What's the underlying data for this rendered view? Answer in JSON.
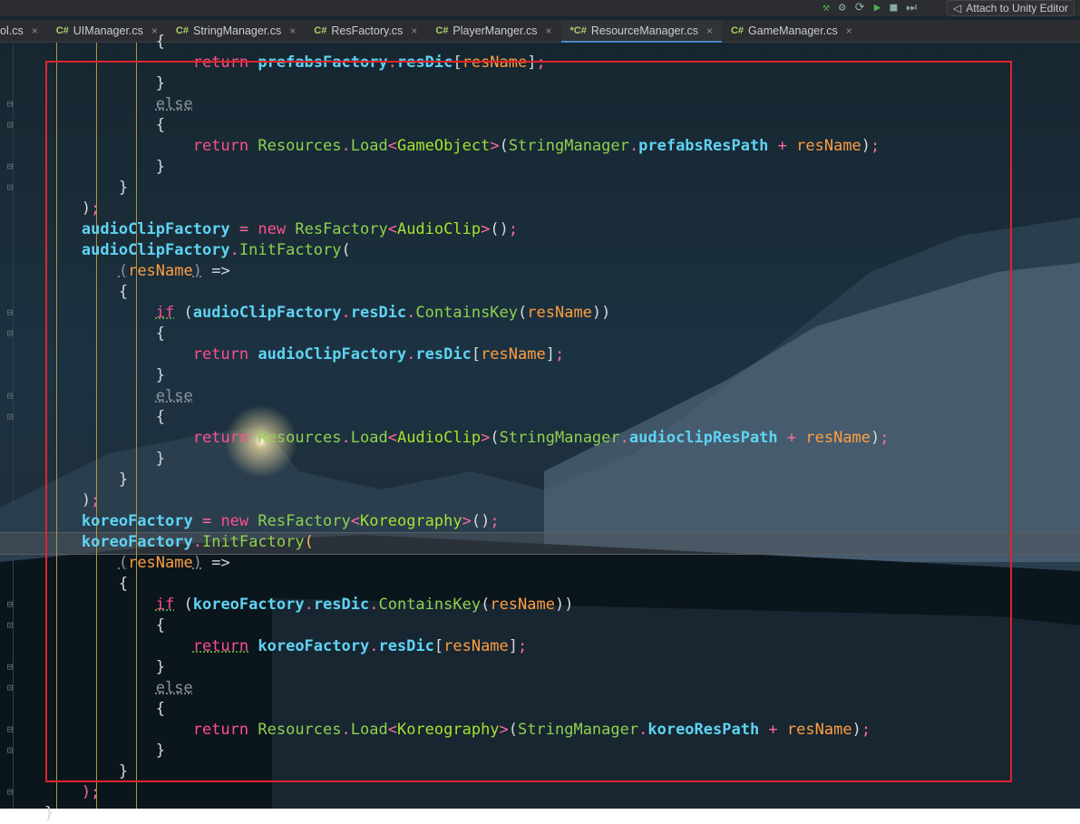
{
  "toolbar": {
    "attach_label": "Attach to Unity Editor",
    "icons": [
      "build-hammer-icon",
      "unity-debug-icon",
      "unity-attach-icon",
      "play-icon",
      "stop-icon",
      "step-icon"
    ]
  },
  "tabs": [
    {
      "label": "ol.cs",
      "cs": false,
      "active": false,
      "modified": false
    },
    {
      "label": "UIManager.cs",
      "cs": true,
      "active": false,
      "modified": false
    },
    {
      "label": "StringManager.cs",
      "cs": true,
      "active": false,
      "modified": false
    },
    {
      "label": "ResFactory.cs",
      "cs": true,
      "active": false,
      "modified": false
    },
    {
      "label": "PlayerManger.cs",
      "cs": true,
      "active": false,
      "modified": false
    },
    {
      "label": "ResourceManager.cs",
      "cs": true,
      "active": true,
      "modified": true
    },
    {
      "label": "GameManager.cs",
      "cs": true,
      "active": false,
      "modified": false
    }
  ],
  "cs_badge": "C#",
  "modified_marker": "*",
  "close_glyph": "×",
  "colors": {
    "annotation_box": "#e0242a",
    "active_tab_underline": "#4a88c7",
    "keyword": "#ff4f8b",
    "field": "#5fd3f3",
    "method": "#8fd14f",
    "type": "#a6e22e",
    "parameter": "#ff9d40"
  },
  "code_lines": [
    [
      {
        "t": "                ",
        "c": ""
      },
      {
        "t": "{",
        "c": "pun"
      }
    ],
    [
      {
        "t": "                    ",
        "c": ""
      },
      {
        "t": "return",
        "c": "k"
      },
      {
        "t": " ",
        "c": ""
      },
      {
        "t": "prefabsFactory",
        "c": "fld"
      },
      {
        "t": ".",
        "c": "op"
      },
      {
        "t": "resDic",
        "c": "fld"
      },
      {
        "t": "[",
        "c": "pun"
      },
      {
        "t": "resName",
        "c": "par"
      },
      {
        "t": "]",
        "c": "pun"
      },
      {
        "t": ";",
        "c": "sem"
      }
    ],
    [
      {
        "t": "                ",
        "c": ""
      },
      {
        "t": "}",
        "c": "pun"
      }
    ],
    [
      {
        "t": "                ",
        "c": ""
      },
      {
        "t": "else",
        "c": "gray"
      }
    ],
    [
      {
        "t": "                ",
        "c": ""
      },
      {
        "t": "{",
        "c": "pun"
      }
    ],
    [
      {
        "t": "                    ",
        "c": ""
      },
      {
        "t": "return",
        "c": "k"
      },
      {
        "t": " ",
        "c": ""
      },
      {
        "t": "Resources",
        "c": "mth"
      },
      {
        "t": ".",
        "c": "op"
      },
      {
        "t": "Load",
        "c": "mth"
      },
      {
        "t": "<",
        "c": "op"
      },
      {
        "t": "GameObject",
        "c": "typ"
      },
      {
        "t": ">",
        "c": "op"
      },
      {
        "t": "(",
        "c": "pun"
      },
      {
        "t": "StringManager",
        "c": "mth"
      },
      {
        "t": ".",
        "c": "op"
      },
      {
        "t": "prefabsResPath",
        "c": "fld"
      },
      {
        "t": " + ",
        "c": "op"
      },
      {
        "t": "resName",
        "c": "par"
      },
      {
        "t": ")",
        "c": "pun"
      },
      {
        "t": ";",
        "c": "sem"
      }
    ],
    [
      {
        "t": "                ",
        "c": ""
      },
      {
        "t": "}",
        "c": "pun"
      }
    ],
    [
      {
        "t": "            ",
        "c": ""
      },
      {
        "t": "}",
        "c": "pun"
      }
    ],
    [
      {
        "t": "        ",
        "c": ""
      },
      {
        "t": ")",
        "c": "pun"
      },
      {
        "t": ";",
        "c": "sem"
      }
    ],
    [
      {
        "t": "        ",
        "c": ""
      },
      {
        "t": "audioClipFactory",
        "c": "fld"
      },
      {
        "t": " = ",
        "c": "op"
      },
      {
        "t": "new",
        "c": "k"
      },
      {
        "t": " ",
        "c": ""
      },
      {
        "t": "ResFactory",
        "c": "mth"
      },
      {
        "t": "<",
        "c": "op"
      },
      {
        "t": "AudioClip",
        "c": "typ"
      },
      {
        "t": ">",
        "c": "op"
      },
      {
        "t": "()",
        "c": "pun"
      },
      {
        "t": ";",
        "c": "sem"
      }
    ],
    [
      {
        "t": "        ",
        "c": ""
      },
      {
        "t": "audioClipFactory",
        "c": "fld"
      },
      {
        "t": ".",
        "c": "op"
      },
      {
        "t": "InitFactory",
        "c": "mth"
      },
      {
        "t": "(",
        "c": "pun"
      }
    ],
    [
      {
        "t": "            ",
        "c": ""
      },
      {
        "t": "(",
        "c": "gray"
      },
      {
        "t": "resName",
        "c": "par"
      },
      {
        "t": ")",
        "c": "gray"
      },
      {
        "t": " =>",
        "c": "pun"
      }
    ],
    [
      {
        "t": "            ",
        "c": ""
      },
      {
        "t": "{",
        "c": "pun"
      }
    ],
    [
      {
        "t": "                ",
        "c": ""
      },
      {
        "t": "if",
        "c": "kw"
      },
      {
        "t": " (",
        "c": "pun"
      },
      {
        "t": "audioClipFactory",
        "c": "fld"
      },
      {
        "t": ".",
        "c": "op"
      },
      {
        "t": "resDic",
        "c": "fld"
      },
      {
        "t": ".",
        "c": "op"
      },
      {
        "t": "ContainsKey",
        "c": "mth"
      },
      {
        "t": "(",
        "c": "pun"
      },
      {
        "t": "resName",
        "c": "par"
      },
      {
        "t": "))",
        "c": "pun"
      }
    ],
    [
      {
        "t": "                ",
        "c": ""
      },
      {
        "t": "{",
        "c": "pun"
      }
    ],
    [
      {
        "t": "                    ",
        "c": ""
      },
      {
        "t": "return",
        "c": "k"
      },
      {
        "t": " ",
        "c": ""
      },
      {
        "t": "audioClipFactory",
        "c": "fld"
      },
      {
        "t": ".",
        "c": "op"
      },
      {
        "t": "resDic",
        "c": "fld"
      },
      {
        "t": "[",
        "c": "pun"
      },
      {
        "t": "resName",
        "c": "par"
      },
      {
        "t": "]",
        "c": "pun"
      },
      {
        "t": ";",
        "c": "sem"
      }
    ],
    [
      {
        "t": "                ",
        "c": ""
      },
      {
        "t": "}",
        "c": "pun"
      }
    ],
    [
      {
        "t": "                ",
        "c": ""
      },
      {
        "t": "else",
        "c": "gray"
      }
    ],
    [
      {
        "t": "                ",
        "c": ""
      },
      {
        "t": "{",
        "c": "pun"
      }
    ],
    [
      {
        "t": "                    ",
        "c": ""
      },
      {
        "t": "return",
        "c": "k"
      },
      {
        "t": " ",
        "c": ""
      },
      {
        "t": "Resources",
        "c": "mth"
      },
      {
        "t": ".",
        "c": "op"
      },
      {
        "t": "Load",
        "c": "mth"
      },
      {
        "t": "<",
        "c": "op"
      },
      {
        "t": "AudioClip",
        "c": "typ"
      },
      {
        "t": ">",
        "c": "op"
      },
      {
        "t": "(",
        "c": "pun"
      },
      {
        "t": "StringManager",
        "c": "mth"
      },
      {
        "t": ".",
        "c": "op"
      },
      {
        "t": "audioclipResPath",
        "c": "fld"
      },
      {
        "t": " + ",
        "c": "op"
      },
      {
        "t": "resName",
        "c": "par"
      },
      {
        "t": ")",
        "c": "pun"
      },
      {
        "t": ";",
        "c": "sem"
      }
    ],
    [
      {
        "t": "                ",
        "c": ""
      },
      {
        "t": "}",
        "c": "pun"
      }
    ],
    [
      {
        "t": "            ",
        "c": ""
      },
      {
        "t": "}",
        "c": "pun"
      }
    ],
    [
      {
        "t": "        ",
        "c": ""
      },
      {
        "t": ")",
        "c": "pun"
      },
      {
        "t": ";",
        "c": "sem"
      }
    ],
    [
      {
        "t": "        ",
        "c": ""
      },
      {
        "t": "koreoFactory",
        "c": "fld"
      },
      {
        "t": " = ",
        "c": "op"
      },
      {
        "t": "new",
        "c": "k"
      },
      {
        "t": " ",
        "c": ""
      },
      {
        "t": "ResFactory",
        "c": "mth"
      },
      {
        "t": "<",
        "c": "op"
      },
      {
        "t": "Koreography",
        "c": "typ"
      },
      {
        "t": ">",
        "c": "op"
      },
      {
        "t": "()",
        "c": "pun"
      },
      {
        "t": ";",
        "c": "sem"
      }
    ],
    [
      {
        "t": "        ",
        "c": ""
      },
      {
        "t": "koreoFactory",
        "c": "fld"
      },
      {
        "t": ".",
        "c": "op"
      },
      {
        "t": "InitFactory",
        "c": "mth"
      },
      {
        "t": "(",
        "c": "dim"
      }
    ],
    [
      {
        "t": "            ",
        "c": ""
      },
      {
        "t": "(",
        "c": "gray"
      },
      {
        "t": "resName",
        "c": "par"
      },
      {
        "t": ")",
        "c": "gray"
      },
      {
        "t": " =>",
        "c": "pun"
      }
    ],
    [
      {
        "t": "            ",
        "c": ""
      },
      {
        "t": "{",
        "c": "pun"
      }
    ],
    [
      {
        "t": "                ",
        "c": ""
      },
      {
        "t": "if",
        "c": "kw"
      },
      {
        "t": " (",
        "c": "pun"
      },
      {
        "t": "koreoFactory",
        "c": "fld"
      },
      {
        "t": ".",
        "c": "op"
      },
      {
        "t": "resDic",
        "c": "fld"
      },
      {
        "t": ".",
        "c": "op"
      },
      {
        "t": "ContainsKey",
        "c": "mth"
      },
      {
        "t": "(",
        "c": "pun"
      },
      {
        "t": "resName",
        "c": "par"
      },
      {
        "t": "))",
        "c": "pun"
      }
    ],
    [
      {
        "t": "                ",
        "c": ""
      },
      {
        "t": "{",
        "c": "pun"
      }
    ],
    [
      {
        "t": "                    ",
        "c": ""
      },
      {
        "t": "return",
        "c": "kw"
      },
      {
        "t": " ",
        "c": ""
      },
      {
        "t": "koreoFactory",
        "c": "fld"
      },
      {
        "t": ".",
        "c": "op"
      },
      {
        "t": "resDic",
        "c": "fld"
      },
      {
        "t": "[",
        "c": "pun"
      },
      {
        "t": "resName",
        "c": "par"
      },
      {
        "t": "]",
        "c": "pun"
      },
      {
        "t": ";",
        "c": "sem"
      }
    ],
    [
      {
        "t": "                ",
        "c": ""
      },
      {
        "t": "}",
        "c": "pun"
      }
    ],
    [
      {
        "t": "                ",
        "c": ""
      },
      {
        "t": "else",
        "c": "gray"
      }
    ],
    [
      {
        "t": "                ",
        "c": ""
      },
      {
        "t": "{",
        "c": "pun"
      }
    ],
    [
      {
        "t": "                    ",
        "c": ""
      },
      {
        "t": "return",
        "c": "k"
      },
      {
        "t": " ",
        "c": ""
      },
      {
        "t": "Resources",
        "c": "mth"
      },
      {
        "t": ".",
        "c": "op"
      },
      {
        "t": "Load",
        "c": "mth"
      },
      {
        "t": "<",
        "c": "op"
      },
      {
        "t": "Koreography",
        "c": "typ"
      },
      {
        "t": ">",
        "c": "op"
      },
      {
        "t": "(",
        "c": "pun"
      },
      {
        "t": "StringManager",
        "c": "mth"
      },
      {
        "t": ".",
        "c": "op"
      },
      {
        "t": "koreoResPath",
        "c": "fld"
      },
      {
        "t": " + ",
        "c": "op"
      },
      {
        "t": "resName",
        "c": "par"
      },
      {
        "t": ")",
        "c": "pun"
      },
      {
        "t": ";",
        "c": "sem"
      }
    ],
    [
      {
        "t": "                ",
        "c": ""
      },
      {
        "t": "}",
        "c": "pun"
      }
    ],
    [
      {
        "t": "            ",
        "c": ""
      },
      {
        "t": "}",
        "c": "pun"
      }
    ],
    [
      {
        "t": "        ",
        "c": ""
      },
      {
        "t": ")",
        "c": "sem"
      },
      {
        "t": ";",
        "c": "sem"
      }
    ],
    [
      {
        "t": "    ",
        "c": ""
      },
      {
        "t": "}",
        "c": "pun"
      }
    ]
  ],
  "current_line_index": 24
}
